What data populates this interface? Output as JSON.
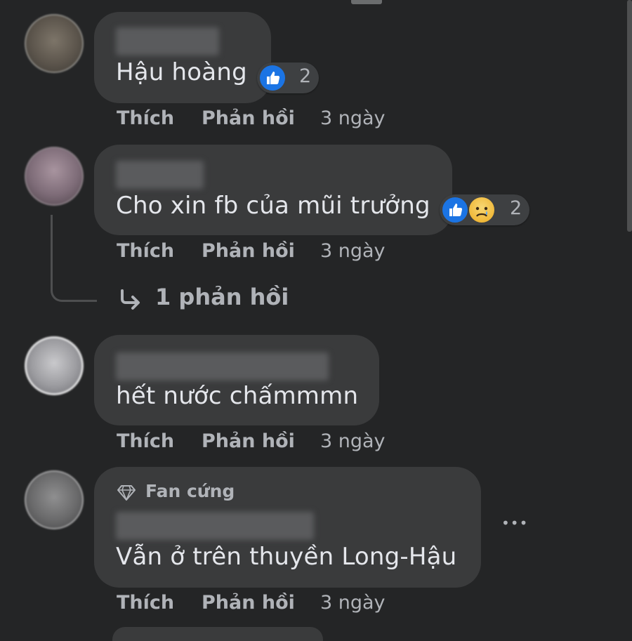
{
  "comments": [
    {
      "text": "Hậu hoàng",
      "reaction_count": "2",
      "like": "Thích",
      "reply": "Phản hồi",
      "time": "3 ngày"
    },
    {
      "text": "Cho xin fb của mũi trưởng",
      "reaction_count": "2",
      "like": "Thích",
      "reply": "Phản hồi",
      "time": "3 ngày",
      "replies_link": "1 phản hồi"
    },
    {
      "text": "hết nước chấmmmn",
      "like": "Thích",
      "reply": "Phản hồi",
      "time": "3 ngày"
    },
    {
      "badge": "Fan cứng",
      "text": "Vẫn ở trên thuyền Long-Hậu",
      "like": "Thích",
      "reply": "Phản hồi",
      "time": "3 ngày",
      "more": "•••"
    }
  ],
  "colors": {
    "background": "#242526",
    "bubble": "#3a3b3c",
    "text": "#e4e6eb",
    "secondary": "#b0b3b8",
    "like": "#1b74e4"
  },
  "icons": [
    "like-icon",
    "sad-icon",
    "reply-arrow-icon",
    "diamond-icon",
    "more-icon"
  ]
}
